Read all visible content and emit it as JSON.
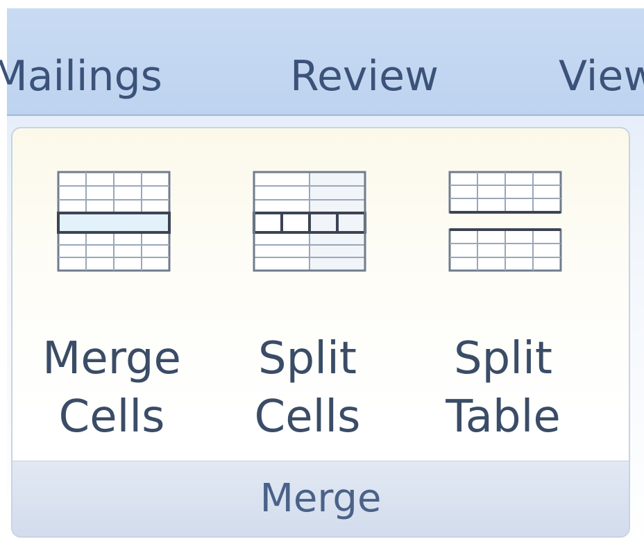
{
  "tabs": [
    {
      "label": "Mailings"
    },
    {
      "label": "Review"
    },
    {
      "label": "View"
    }
  ],
  "group": {
    "label": "Merge",
    "buttons": [
      {
        "line1": "Merge",
        "line2": "Cells",
        "icon": "merge-cells-icon"
      },
      {
        "line1": "Split",
        "line2": "Cells",
        "icon": "split-cells-icon"
      },
      {
        "line1": "Split",
        "line2": "Table",
        "icon": "split-table-icon"
      }
    ]
  },
  "colors": {
    "tab_bar": "#c9dbf3",
    "tab_text": "#3b5379",
    "label_text": "#3a4c66",
    "group_footer": "#d3dced"
  }
}
